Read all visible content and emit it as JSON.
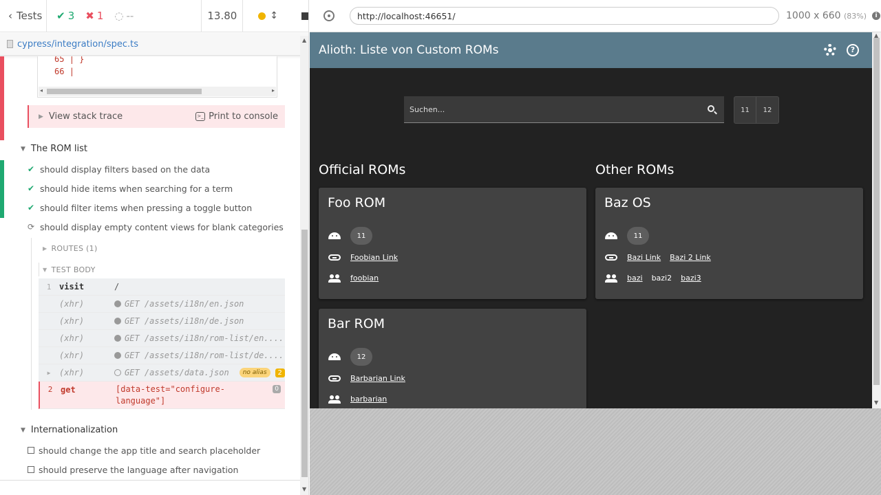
{
  "reporter": {
    "tests_label": "Tests",
    "passed": "3",
    "failed": "1",
    "pending": "--",
    "duration": "13.80",
    "spec_path": "cypress/integration/spec.ts",
    "code_lines": [
      {
        "num": "65",
        "text": "| }"
      },
      {
        "num": "66",
        "text": "|"
      }
    ],
    "view_stack_trace": "View stack trace",
    "print_to_console": "Print to console",
    "suite_rom_list": "The ROM list",
    "tests": [
      {
        "title": "should display filters based on the data",
        "state": "passed"
      },
      {
        "title": "should hide items when searching for a term",
        "state": "passed"
      },
      {
        "title": "should filter items when pressing a toggle button",
        "state": "passed"
      },
      {
        "title": "should display empty content views for blank categories",
        "state": "running"
      }
    ],
    "routes_label": "ROUTES (1)",
    "test_body_label": "TEST BODY",
    "commands": [
      {
        "num": "1",
        "name": "visit",
        "msg": "/"
      },
      {
        "num": "",
        "name": "(xhr)",
        "msg": "GET /assets/i18n/en.json"
      },
      {
        "num": "",
        "name": "(xhr)",
        "msg": "GET /assets/i18n/de.json"
      },
      {
        "num": "",
        "name": "(xhr)",
        "msg": "GET /assets/i18n/rom-list/en...."
      },
      {
        "num": "",
        "name": "(xhr)",
        "msg": "GET /assets/i18n/rom-list/de...."
      },
      {
        "num": "",
        "name": "(xhr)",
        "msg": "GET /assets/data.json",
        "alias": "no alias",
        "count": "2"
      }
    ],
    "fail_command": {
      "num": "2",
      "name": "get",
      "msg": "[data-test=\"configure-language\"]",
      "badge": "0"
    },
    "suite_i18n": "Internationalization",
    "i18n_tests": [
      "should change the app title and search placeholder",
      "should preserve the language after navigation"
    ]
  },
  "aut": {
    "url": "http://localhost:46651/",
    "viewport": "1000 x 660",
    "zoom": "(83%)",
    "app_title": "Alioth: Liste von Custom ROMs",
    "search_placeholder": "Suchen...",
    "toggles": [
      "11",
      "12"
    ],
    "official_title": "Official ROMs",
    "other_title": "Other ROMs",
    "cards": {
      "foo": {
        "title": "Foo ROM",
        "version": "11",
        "links": [
          "Foobian Link"
        ],
        "maintainers": [
          "foobian"
        ]
      },
      "baz": {
        "title": "Baz OS",
        "version": "11",
        "links": [
          "Bazi Link",
          "Bazi 2 Link"
        ],
        "maintainers": [
          "bazi",
          "bazi2",
          "bazi3"
        ]
      },
      "bar": {
        "title": "Bar ROM",
        "version": "12",
        "links": [
          "Barbarian Link"
        ],
        "maintainers": [
          "barbarian"
        ]
      }
    }
  }
}
